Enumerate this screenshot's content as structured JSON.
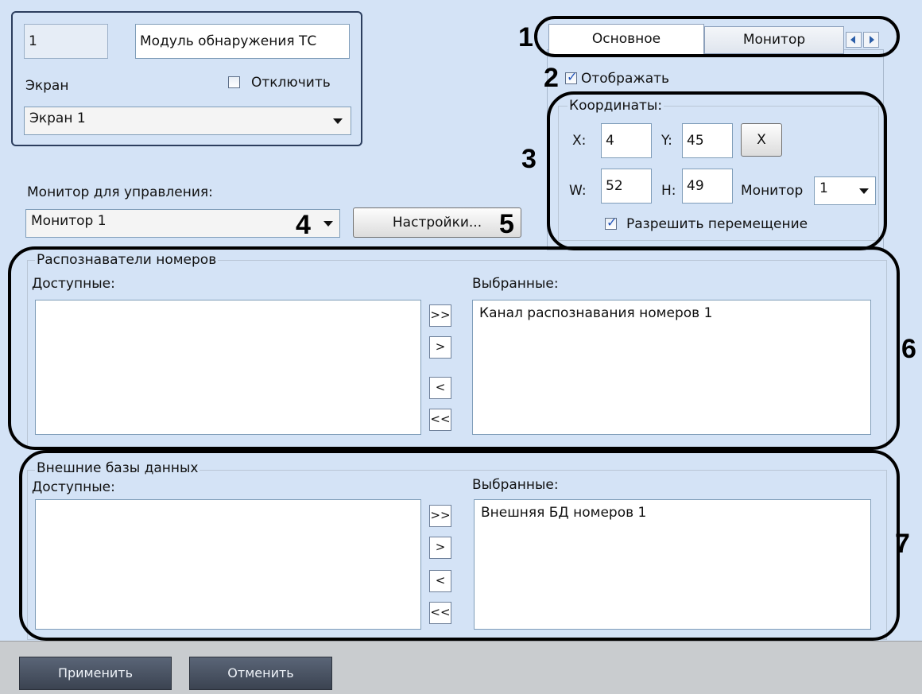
{
  "camera": {
    "number": "1",
    "name": "Модуль обнаружения ТС",
    "screen_label": "Экран",
    "disable_label": "Отключить",
    "screen_value": "Экран 1"
  },
  "control": {
    "monitor_label": "Монитор для управления:",
    "monitor_value": "Монитор 1",
    "settings_button": "Настройки..."
  },
  "tabs": {
    "items": [
      "Основное",
      "Монитор"
    ]
  },
  "display": {
    "show_label": "Отображать",
    "coords_title": "Координаты:",
    "x_label": "X:",
    "x_value": "4",
    "y_label": "Y:",
    "y_value": "45",
    "w_label": "W:",
    "w_value": "52",
    "h_label": "H:",
    "h_value": "49",
    "reset_button": "X",
    "monitor_label": "Монитор",
    "monitor_value": "1",
    "allow_move_label": "Разрешить перемещение"
  },
  "recognizers": {
    "title": "Распознаватели номеров",
    "available_label": "Доступные:",
    "selected_label": "Выбранные:",
    "selected_items": [
      "Канал распознавания номеров 1"
    ]
  },
  "databases": {
    "title": "Внешние базы данных",
    "available_label": "Доступные:",
    "selected_label": "Выбранные:",
    "selected_items": [
      "Внешняя БД номеров 1"
    ]
  },
  "transfer_buttons": {
    "add_all": ">>",
    "add": ">",
    "remove": "<",
    "remove_all": "<<"
  },
  "footer": {
    "apply": "Применить",
    "cancel": "Отменить"
  },
  "callouts": [
    "1",
    "2",
    "3",
    "4",
    "5",
    "6",
    "7"
  ]
}
